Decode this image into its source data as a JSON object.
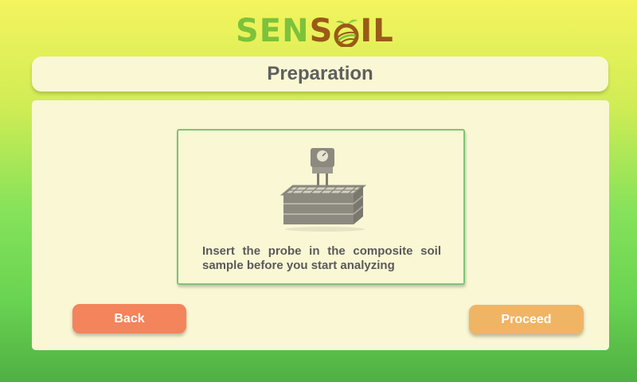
{
  "logo": {
    "text_prefix": "SEN",
    "text_s": "S",
    "text_suffix": "IL",
    "alt": "SENSOIL"
  },
  "header": {
    "title": "Preparation"
  },
  "card": {
    "illustration_icon": "soil-probe-in-tray-icon",
    "instruction": "Insert the probe in the composite soil sample before you start analyzing"
  },
  "actions": {
    "back_label": "Back",
    "proceed_label": "Proceed"
  },
  "colors": {
    "logo_green": "#7cc23a",
    "logo_brown": "#9a5a18",
    "panel_bg": "#f9f7d4",
    "card_border": "#7cc477",
    "back_button": "#f3845c",
    "proceed_button": "#f0b465",
    "text_gray": "#5a5a5a"
  }
}
